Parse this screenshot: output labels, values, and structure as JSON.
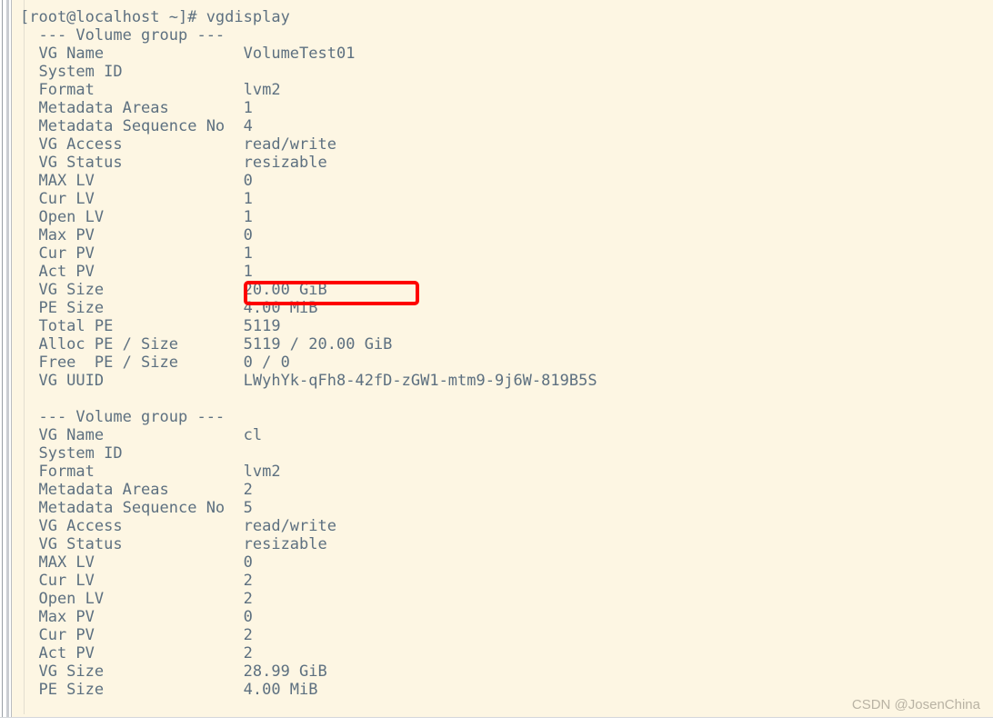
{
  "window": {
    "background_color": "#fdf6e3",
    "text_color": "#5d7080",
    "accent_color": "#fe0000"
  },
  "terminal": {
    "prompt_line": "[root@localhost ~]# vgdisplay",
    "prompt": "[root@localhost ~]#",
    "command": "vgdisplay",
    "lines": [
      "[root@localhost ~]# vgdisplay",
      "  --- Volume group ---",
      "  VG Name               VolumeTest01",
      "  System ID",
      "  Format                lvm2",
      "  Metadata Areas        1",
      "  Metadata Sequence No  4",
      "  VG Access             read/write",
      "  VG Status             resizable",
      "  MAX LV                0",
      "  Cur LV                1",
      "  Open LV               1",
      "  Max PV                0",
      "  Cur PV                1",
      "  Act PV                1",
      "  VG Size               20.00 GiB",
      "  PE Size               4.00 MiB",
      "  Total PE              5119",
      "  Alloc PE / Size       5119 / 20.00 GiB",
      "  Free  PE / Size       0 / 0",
      "  VG UUID               LWyhYk-qFh8-42fD-zGW1-mtm9-9j6W-819B5S",
      "",
      "  --- Volume group ---",
      "  VG Name               cl",
      "  System ID",
      "  Format                lvm2",
      "  Metadata Areas        2",
      "  Metadata Sequence No  5",
      "  VG Access             read/write",
      "  VG Status             resizable",
      "  MAX LV                0",
      "  Cur LV                2",
      "  Open LV               2",
      "  Max PV                0",
      "  Cur PV                2",
      "  Act PV                2",
      "  VG Size               28.99 GiB",
      "  PE Size               4.00 MiB"
    ]
  },
  "volume_groups": [
    {
      "header": "--- Volume group ---",
      "fields": [
        {
          "label": "VG Name",
          "value": "VolumeTest01"
        },
        {
          "label": "System ID",
          "value": ""
        },
        {
          "label": "Format",
          "value": "lvm2"
        },
        {
          "label": "Metadata Areas",
          "value": "1"
        },
        {
          "label": "Metadata Sequence No",
          "value": "4"
        },
        {
          "label": "VG Access",
          "value": "read/write"
        },
        {
          "label": "VG Status",
          "value": "resizable"
        },
        {
          "label": "MAX LV",
          "value": "0"
        },
        {
          "label": "Cur LV",
          "value": "1"
        },
        {
          "label": "Open LV",
          "value": "1"
        },
        {
          "label": "Max PV",
          "value": "0"
        },
        {
          "label": "Cur PV",
          "value": "1"
        },
        {
          "label": "Act PV",
          "value": "1"
        },
        {
          "label": "VG Size",
          "value": "20.00 GiB"
        },
        {
          "label": "PE Size",
          "value": "4.00 MiB"
        },
        {
          "label": "Total PE",
          "value": "5119"
        },
        {
          "label": "Alloc PE / Size",
          "value": "5119 / 20.00 GiB"
        },
        {
          "label": "Free  PE / Size",
          "value": "0 / 0"
        },
        {
          "label": "VG UUID",
          "value": "LWyhYk-qFh8-42fD-zGW1-mtm9-9j6W-819B5S"
        }
      ]
    },
    {
      "header": "--- Volume group ---",
      "fields": [
        {
          "label": "VG Name",
          "value": "cl"
        },
        {
          "label": "System ID",
          "value": ""
        },
        {
          "label": "Format",
          "value": "lvm2"
        },
        {
          "label": "Metadata Areas",
          "value": "2"
        },
        {
          "label": "Metadata Sequence No",
          "value": "5"
        },
        {
          "label": "VG Access",
          "value": "read/write"
        },
        {
          "label": "VG Status",
          "value": "resizable"
        },
        {
          "label": "MAX LV",
          "value": "0"
        },
        {
          "label": "Cur LV",
          "value": "2"
        },
        {
          "label": "Open LV",
          "value": "2"
        },
        {
          "label": "Max PV",
          "value": "0"
        },
        {
          "label": "Cur PV",
          "value": "2"
        },
        {
          "label": "Act PV",
          "value": "2"
        },
        {
          "label": "VG Size",
          "value": "28.99 GiB"
        },
        {
          "label": "PE Size",
          "value": "4.00 MiB"
        }
      ]
    }
  ],
  "annotation": {
    "highlighted_value": "20.00 GiB",
    "highlight_color": "#fe0000",
    "shape": "rounded-rectangle"
  },
  "watermark": {
    "text": "CSDN @JosenChina"
  }
}
